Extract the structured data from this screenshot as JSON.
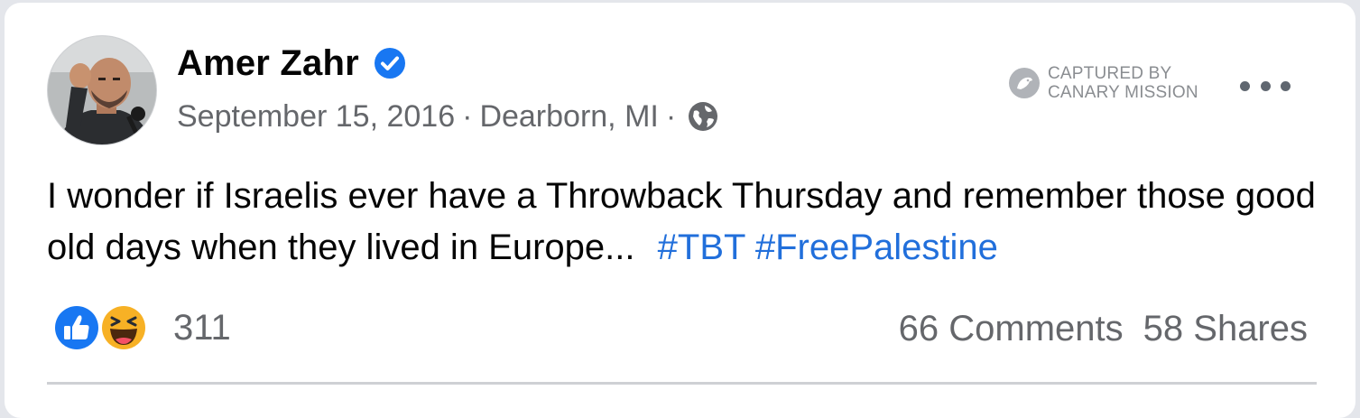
{
  "post": {
    "author": {
      "name": "Amer Zahr",
      "verified": true,
      "avatar_icon": "profile-photo"
    },
    "meta": {
      "date": "September 15, 2016",
      "separator": "·",
      "location": "Dearborn, MI",
      "audience_icon": "globe-icon"
    },
    "watermark": {
      "line1": "CAPTURED BY",
      "line2": "CANARY MISSION",
      "logo_icon": "canary-icon"
    },
    "more_icon": "more-options-icon",
    "text": "I wonder if Israelis ever have a Throwback Thursday and remember those good old days when they lived in Europe...",
    "hashtags": [
      "#TBT",
      "#FreePalestine"
    ],
    "reactions": {
      "icons": [
        "like-icon",
        "haha-icon"
      ],
      "count": "311"
    },
    "stats": {
      "comments": "66 Comments",
      "shares": "58 Shares"
    }
  },
  "colors": {
    "hashtag": "#216fdb",
    "verified": "#1877f2",
    "secondary_text": "#65676b",
    "primary_text": "#050505",
    "like": "#1877f2",
    "haha": "#f7b125"
  }
}
